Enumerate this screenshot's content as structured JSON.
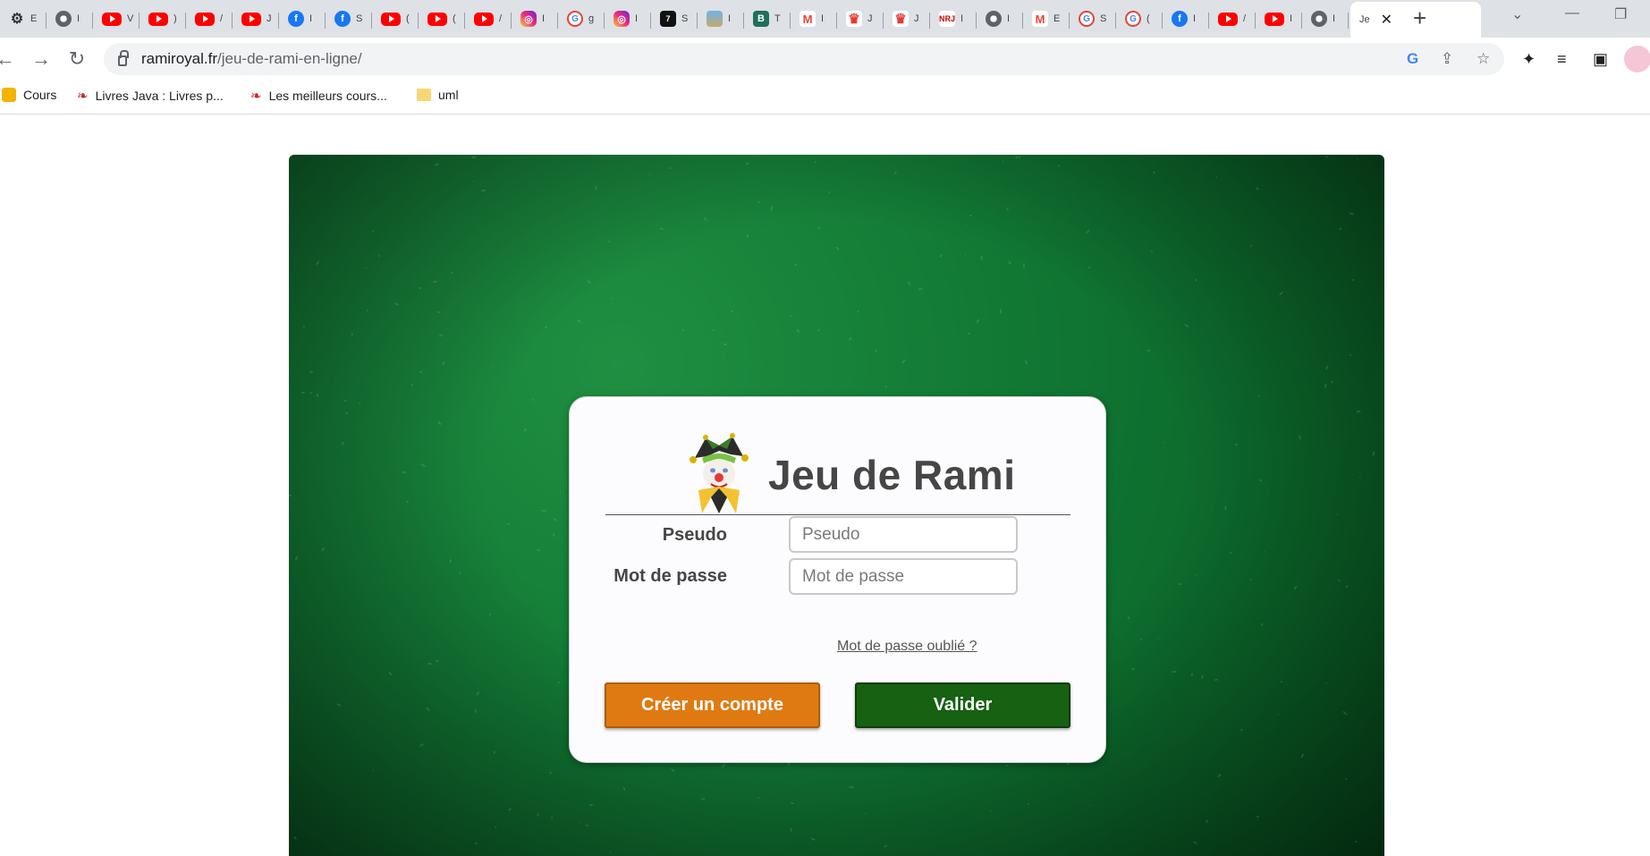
{
  "browser": {
    "tabs": [
      {
        "icon": "gear-icon",
        "label": "E",
        "glyph": "⚙"
      },
      {
        "icon": "chrome-icon",
        "label": "I",
        "glyph": ""
      },
      {
        "icon": "youtube-icon",
        "label": "V",
        "glyph": ""
      },
      {
        "icon": "youtube-icon",
        "label": ")",
        "glyph": ""
      },
      {
        "icon": "youtube-icon",
        "label": "/",
        "glyph": ""
      },
      {
        "icon": "youtube-icon",
        "label": "J",
        "glyph": ""
      },
      {
        "icon": "facebook-icon",
        "label": "I",
        "glyph": "f"
      },
      {
        "icon": "facebook-icon",
        "label": "S",
        "glyph": "f"
      },
      {
        "icon": "youtube-icon",
        "label": "(",
        "glyph": ""
      },
      {
        "icon": "youtube-icon",
        "label": "(",
        "glyph": ""
      },
      {
        "icon": "youtube-icon",
        "label": "/",
        "glyph": ""
      },
      {
        "icon": "instagram-icon",
        "label": "I",
        "glyph": "◎"
      },
      {
        "icon": "google-icon",
        "label": "g",
        "glyph": "G"
      },
      {
        "icon": "instagram-icon",
        "label": "I",
        "glyph": "◎"
      },
      {
        "icon": "news-icon",
        "label": "S",
        "glyph": "7"
      },
      {
        "icon": "photo-icon",
        "label": "I",
        "glyph": ""
      },
      {
        "icon": "b-logo-icon",
        "label": "T",
        "glyph": "B"
      },
      {
        "icon": "gmail-icon",
        "label": "I",
        "glyph": "M"
      },
      {
        "icon": "crown-icon",
        "label": "J",
        "glyph": "♛"
      },
      {
        "icon": "crown-icon",
        "label": "J",
        "glyph": "♛"
      },
      {
        "icon": "nrj-icon",
        "label": "I",
        "glyph": "NRJ"
      },
      {
        "icon": "chrome-icon",
        "label": "I",
        "glyph": ""
      },
      {
        "icon": "gmail-icon",
        "label": "E",
        "glyph": "M"
      },
      {
        "icon": "google-icon",
        "label": "S",
        "glyph": "G"
      },
      {
        "icon": "google-icon",
        "label": "(",
        "glyph": "G"
      },
      {
        "icon": "facebook-icon",
        "label": "I",
        "glyph": "f"
      },
      {
        "icon": "youtube-icon",
        "label": "/",
        "glyph": ""
      },
      {
        "icon": "youtube-icon",
        "label": "I",
        "glyph": ""
      },
      {
        "icon": "chrome-icon",
        "label": "I",
        "glyph": ""
      }
    ],
    "active_tab_label": "Je",
    "url_domain": "ramiroyal.fr",
    "url_path": "/jeu-de-rami-en-ligne/",
    "bookmarks": [
      {
        "label": "Cours",
        "icon": "classroom-icon"
      },
      {
        "label": "Livres Java : Livres p...",
        "icon": "book-icon"
      },
      {
        "label": "Les meilleurs cours...",
        "icon": "book-icon"
      },
      {
        "label": "uml",
        "icon": "folder-icon"
      }
    ]
  },
  "login": {
    "title": "Jeu de Rami",
    "pseudo_label": "Pseudo",
    "pseudo_placeholder": "Pseudo",
    "password_label": "Mot de passe",
    "password_placeholder": "Mot de passe",
    "forgot_link": "Mot de passe oublié ?",
    "create_button": "Créer un compte",
    "submit_button": "Valider"
  },
  "colors": {
    "felt_green": "#127a35",
    "create_orange": "#df7a12",
    "submit_green": "#176112",
    "text_dark": "#464646"
  }
}
